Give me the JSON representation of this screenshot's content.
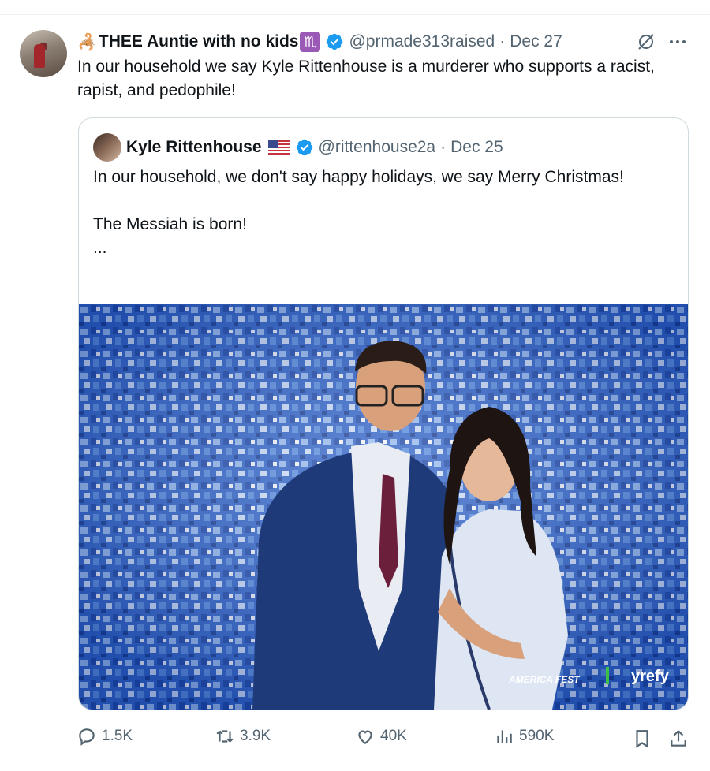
{
  "tweet": {
    "author": {
      "display_name": "THEE Auntie with no kids",
      "emoji_prefix": "🦂",
      "zodiac_badge": "♏",
      "handle": "@prmade313raised",
      "verified": true
    },
    "date": "Dec 27",
    "separator": "·",
    "text": "In our household we say Kyle Rittenhouse is a murderer who supports a racist, rapist, and pedophile!",
    "icons": {
      "grok": "grok-icon",
      "more": "more-horizontal-icon",
      "verified": "verified-badge-icon"
    }
  },
  "quote": {
    "author": {
      "display_name": "Kyle Rittenhouse",
      "flag": "🇺🇸",
      "handle": "@rittenhouse2a",
      "verified": true
    },
    "date": "Dec 25",
    "separator": "·",
    "lines": [
      "In our household, we don't say happy holidays, we say Merry Christmas!",
      "",
      "The Messiah is born!",
      "..."
    ],
    "photo": {
      "description_icon": "photo-image",
      "watermark": "yrefy",
      "banner_text": "AMERICA FEST"
    }
  },
  "actions": {
    "reply": {
      "icon": "reply-icon",
      "count": "1.5K"
    },
    "repost": {
      "icon": "repost-icon",
      "count": "3.9K"
    },
    "like": {
      "icon": "heart-icon",
      "count": "40K"
    },
    "views": {
      "icon": "analytics-icon",
      "count": "590K"
    },
    "bookmark": {
      "icon": "bookmark-icon"
    },
    "share": {
      "icon": "share-icon"
    }
  },
  "colors": {
    "text": "#0f1419",
    "secondary": "#536471",
    "verified_blue": "#1d9bf0",
    "border": "#cfd9de",
    "zodiac_purple": "#9b59b6",
    "backdrop_blue": "#2f63c8"
  }
}
